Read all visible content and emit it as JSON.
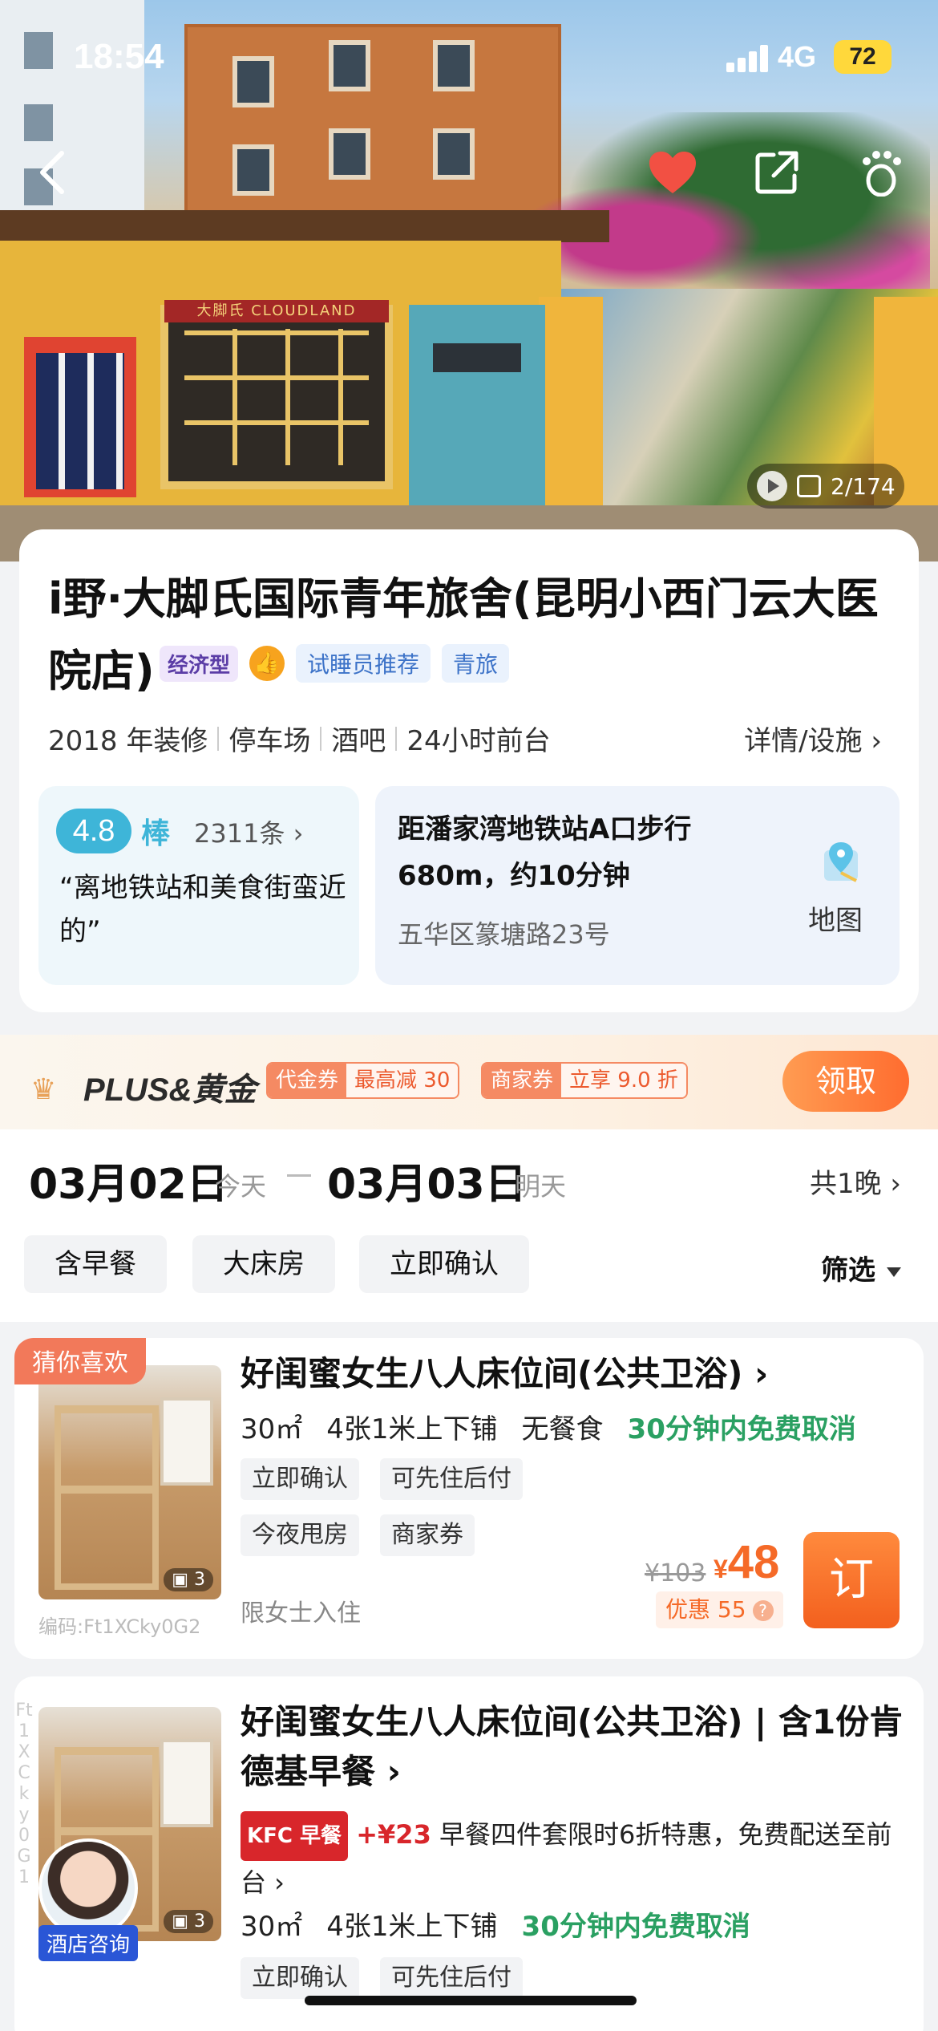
{
  "status_bar": {
    "time": "18:54",
    "network": "4G",
    "battery": "72"
  },
  "hero": {
    "photo_counter": "2/174",
    "sign_text": "大脚氏 CLOUDLAND"
  },
  "hotel": {
    "name": "i野·大脚氏国际青年旅舍(昆明小西门云大医院店)",
    "tags": {
      "type": "经济型",
      "badge_icon": "thumbs-up-icon",
      "sleep_tester": "试睡员推荐",
      "youth": "青旅"
    },
    "facilities": [
      "2018 年装修",
      "停车场",
      "酒吧",
      "24小时前台"
    ],
    "detail_link": "详情/设施 ›",
    "rating": {
      "score": "4.8",
      "word": "棒",
      "count": "2311条 ›",
      "quote": "“离地铁站和美食街蛮近的”"
    },
    "location": {
      "line1": "距潘家湾地铁站A口步行",
      "line2": "680m，约10分钟",
      "address": "五华区篆塘路23号",
      "map_label": "地图"
    }
  },
  "plus": {
    "title": "PLUS&黄金",
    "coupon1": {
      "kind": "代金券",
      "value": "最高减 30"
    },
    "coupon2": {
      "kind": "商家券",
      "value": "立享 9.0 折"
    },
    "claim": "领取"
  },
  "dates": {
    "checkin": "03月02日",
    "checkin_label": "今天",
    "checkout": "03月03日",
    "checkout_label": "明天",
    "nights": "共1晚 ›",
    "filters": [
      "含早餐",
      "大床房",
      "立即确认"
    ],
    "filter_button": "筛选"
  },
  "rooms": [
    {
      "badge": "猜你喜欢",
      "title": "好闺蜜女生八人床位间(公共卫浴) ›",
      "area": "30㎡",
      "beds": "4张1米上下铺",
      "breakfast": "无餐食",
      "cancel": "30分钟内免费取消",
      "chips": [
        "立即确认",
        "可先住后付",
        "今夜甩房",
        "商家券"
      ],
      "note": "限女士入住",
      "code": "编码:Ft1XCky0G2",
      "image_count": "3",
      "old_price": "¥103",
      "currency": "¥",
      "price": "48",
      "discount": "优惠 55",
      "book": "订"
    },
    {
      "title": "好闺蜜女生八人床位间(公共卫浴) | 含1份肯德基早餐 ›",
      "kfc_tag": "KFC 早餐",
      "kfc_price": "+¥23",
      "promo": " 早餐四件套限时6折特惠，免费配送至前台 ›",
      "area": "30㎡",
      "beds": "4张1米上下铺",
      "cancel": "30分钟内免费取消",
      "chips": [
        "立即确认",
        "可先住后付"
      ],
      "vertical_code": "Ft1XCky0G1",
      "consult_label": "酒店咨询",
      "image_count": "3"
    }
  ]
}
